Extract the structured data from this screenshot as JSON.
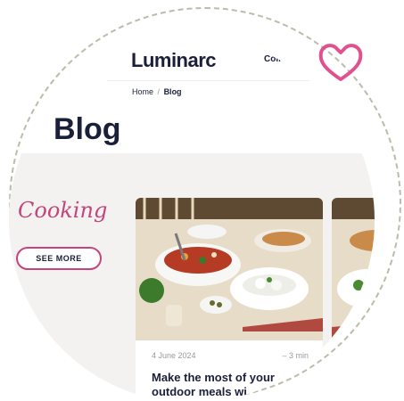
{
  "header": {
    "logo": "Luminarc",
    "nav_item": "Collec"
  },
  "breadcrumb": {
    "home": "Home",
    "separator": "/",
    "current": "Blog"
  },
  "page": {
    "title": "Blog"
  },
  "category": {
    "name": "Cooking",
    "button": "SEE MORE"
  },
  "cards": [
    {
      "date": "4 June 2024",
      "read_time": "– 3 min",
      "title_line1": "Make the most of your",
      "title_line2": "outdoor meals wi"
    }
  ],
  "colors": {
    "accent": "#c2457c",
    "navy": "#1a1f3a",
    "band": "#f3f2f0",
    "dash": "#b9bda9"
  },
  "icons": [
    "heart-icon"
  ]
}
